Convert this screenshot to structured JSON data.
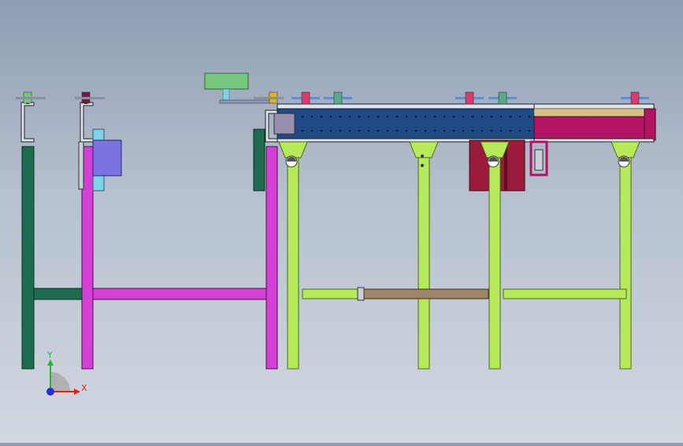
{
  "viewport": {
    "background_top": "#8f9db3",
    "background_bottom": "#d2d8e0"
  },
  "colors": {
    "dark_green": "#1e6b4f",
    "magenta": "#d43fd6",
    "lime": "#b6ea5a",
    "navy": "#1f4a86",
    "crimson": "#b21463",
    "maroon": "#9b1b3d",
    "tan": "#d8c089",
    "brown": "#9c8466",
    "violet": "#7a73e0",
    "light_green": "#77c67e",
    "cyan": "#7fd1e6"
  },
  "triad": {
    "x_label": "X",
    "y_label": "Y",
    "x_color": "#e0201b",
    "y_color": "#25b33a",
    "z_color": "#2a2ad6"
  }
}
